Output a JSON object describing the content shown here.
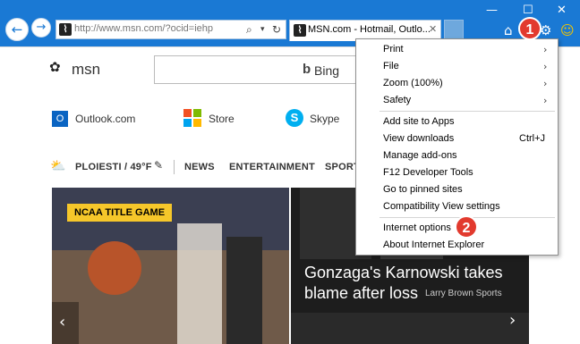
{
  "browser": {
    "address": "http://www.msn.com/?ocid=iehp",
    "tab_title": "MSN.com - Hotmail, Outlo...",
    "back_icon": "arrow-left-icon",
    "forward_icon": "arrow-right-icon"
  },
  "page": {
    "logo_text": "msn",
    "search_brand": "Bing",
    "links": [
      "Outlook.com",
      "Store",
      "Skype"
    ],
    "weather": "PLOIESTI / 49°F",
    "nav": [
      "NEWS",
      "ENTERTAINMENT",
      "SPORT"
    ],
    "card1_badge": "NCAA TITLE GAME",
    "card2_headline": "Gonzaga's Karnowski takes blame after loss",
    "card2_source": "Larry Brown Sports"
  },
  "menu": {
    "items": [
      {
        "label": "Print",
        "submenu": true
      },
      {
        "label": "File",
        "submenu": true
      },
      {
        "label": "Zoom (100%)",
        "submenu": true
      },
      {
        "label": "Safety",
        "submenu": true
      },
      {
        "label": "Add site to Apps"
      },
      {
        "label": "View downloads",
        "shortcut": "Ctrl+J"
      },
      {
        "label": "Manage add-ons"
      },
      {
        "label": "F12 Developer Tools"
      },
      {
        "label": "Go to pinned sites"
      },
      {
        "label": "Compatibility View settings"
      },
      {
        "label": "Internet options"
      },
      {
        "label": "About Internet Explorer"
      }
    ]
  },
  "callouts": [
    "1",
    "2"
  ],
  "colors": {
    "titlebar": "#1a79d4",
    "callout": "#e23a2e",
    "badge": "#f6c72a"
  }
}
